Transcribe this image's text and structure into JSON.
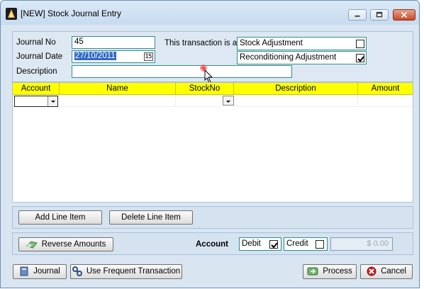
{
  "window": {
    "title": "[NEW] Stock Journal Entry"
  },
  "form": {
    "journal_no_label": "Journal No",
    "journal_no_value": "45",
    "journal_date_label": "Journal Date",
    "journal_date_value": "27/10/2011",
    "description_label": "Description",
    "description_value": "",
    "transaction_label": "This transaction is a:",
    "stock_adjustment_label": "Stock Adjustment",
    "stock_adjustment_checked": false,
    "reconditioning_label": "Reconditioning Adjustment",
    "reconditioning_checked": true
  },
  "grid": {
    "columns": [
      "Account",
      "Name",
      "StockNo",
      "Description",
      "Amount"
    ]
  },
  "line_buttons": {
    "add": "Add Line Item",
    "delete": "Delete Line Item"
  },
  "amount": {
    "reverse_label": "Reverse Amounts",
    "account_label": "Account",
    "debit_label": "Debit",
    "debit_checked": true,
    "credit_label": "Credit",
    "credit_checked": false,
    "amount_value": "$ 0.00"
  },
  "footer": {
    "journal": "Journal",
    "frequent": "Use Frequent Transaction",
    "process": "Process",
    "cancel": "Cancel"
  },
  "icons": {
    "app": "app-logo-icon",
    "reverse": "eraser-icon",
    "journal": "book-icon",
    "frequent": "link-icon",
    "process": "process-icon",
    "cancel": "cancel-icon"
  },
  "colors": {
    "grid_header": "#ffff00",
    "field_border": "#2f8f8f",
    "selection": "#3169c6"
  }
}
